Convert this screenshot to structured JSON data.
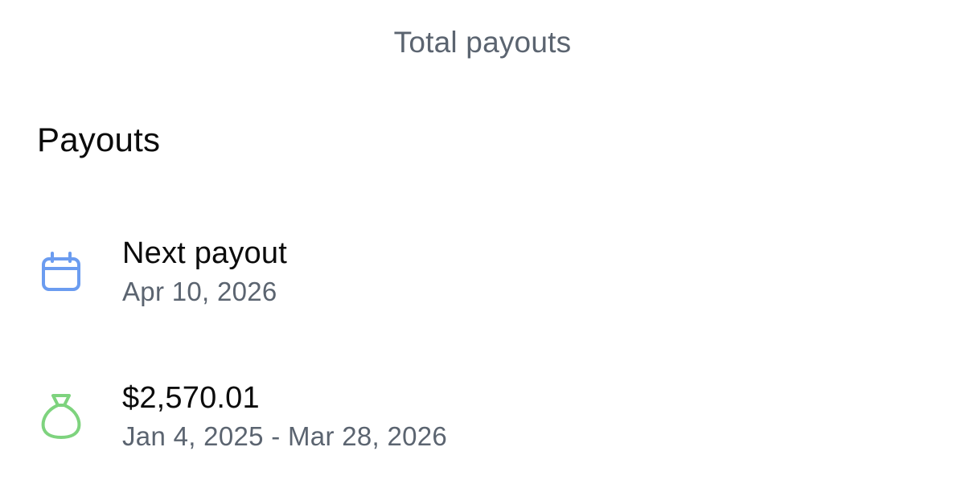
{
  "header": {
    "title": "Total payouts"
  },
  "payouts": {
    "section_title": "Payouts",
    "next_payout": {
      "label": "Next payout",
      "date": "Apr 10, 2026",
      "icon": "calendar-icon",
      "icon_color": "#6b9cf0"
    },
    "total": {
      "amount": "$2,570.01",
      "date_range": "Jan 4, 2025 - Mar 28, 2026",
      "icon": "money-bag-icon",
      "icon_color": "#7ed37e"
    }
  }
}
